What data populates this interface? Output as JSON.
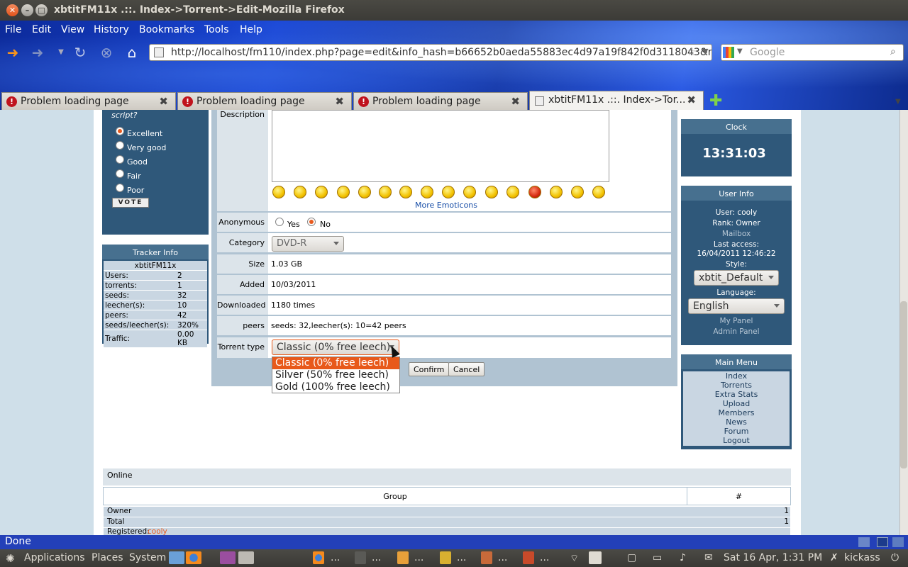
{
  "window": {
    "title": "xbtitFM11x .::. Index->Torrent->Edit-Mozilla Firefox"
  },
  "menubar": {
    "items": [
      "File",
      "Edit",
      "View",
      "History",
      "Bookmarks",
      "Tools",
      "Help"
    ]
  },
  "url": {
    "value": "http://localhost/fm110/index.php?page=edit&info_hash=b66652b0aeda55883ec4d97a19f842f0d3118043&r"
  },
  "search": {
    "placeholder": "Google"
  },
  "tabs": [
    {
      "label": "Problem loading page"
    },
    {
      "label": "Problem loading page"
    },
    {
      "label": "Problem loading page"
    },
    {
      "label": "xbtitFM11x .::. Index->Tor..."
    }
  ],
  "poll": {
    "question": "script?",
    "options": [
      "Excellent",
      "Very good",
      "Good",
      "Fair",
      "Poor"
    ],
    "selected": "Excellent",
    "vote": "VOTE"
  },
  "tracker": {
    "title": "Tracker Info",
    "name": "xbtitFM11x",
    "rows": [
      [
        "Users:",
        "2"
      ],
      [
        "torrents:",
        "1"
      ],
      [
        "seeds:",
        "32"
      ],
      [
        "leecher(s):",
        "10"
      ],
      [
        "peers:",
        "42"
      ],
      [
        "seeds/leecher(s):",
        "320%"
      ],
      [
        "Traffic:",
        "0.00 KB"
      ]
    ]
  },
  "form": {
    "description_label": "Description",
    "more_emoticons": "More Emoticons",
    "anonymous_label": "Anonymous",
    "yes": "Yes",
    "no": "No",
    "anonymous_value": "No",
    "category_label": "Category",
    "category_value": "DVD-R",
    "size_label": "Size",
    "size_value": "1.03 GB",
    "added_label": "Added",
    "added_value": "10/03/2011",
    "downloaded_label": "Downloaded",
    "downloaded_value": "1180 times",
    "peers_label": "peers",
    "peers_value": "seeds: 32,leecher(s): 10=42 peers",
    "type_label": "Torrent type",
    "type_value": "Classic (0% free leech)",
    "type_options": [
      "Classic (0% free leech)",
      "Silver (50% free leech)",
      "Gold (100% free leech)"
    ],
    "confirm": "Confirm",
    "cancel": "Cancel"
  },
  "clock": {
    "title": "Clock",
    "time": "13:31:03"
  },
  "userinfo": {
    "title": "User Info",
    "user": "User: cooly",
    "rank": "Rank: Owner",
    "mailbox": "Mailbox",
    "last_access_label": "Last access:",
    "last_access": "16/04/2011 12:46:22",
    "style_label": "Style:",
    "style": "xbtit_Default",
    "language_label": "Language:",
    "language": "English",
    "my_panel": "My Panel",
    "admin_panel": "Admin Panel"
  },
  "mainmenu": {
    "title": "Main Menu",
    "items": [
      "Index",
      "Torrents",
      "Extra Stats",
      "Upload",
      "Members",
      "News",
      "Forum",
      "Logout"
    ]
  },
  "online": {
    "title": "Online",
    "col_group": "Group",
    "col_count": "#",
    "rows": [
      [
        "Owner",
        "1"
      ],
      [
        "Total",
        "1"
      ]
    ],
    "registered_label": "Registered:",
    "registered_user": "cooly"
  },
  "status": {
    "text": "Done"
  },
  "panel": {
    "applications": "Applications",
    "places": "Places",
    "system": "System",
    "clock": "Sat 16 Apr,  1:31 PM",
    "user": "kickass",
    "ellipsis": "..."
  }
}
